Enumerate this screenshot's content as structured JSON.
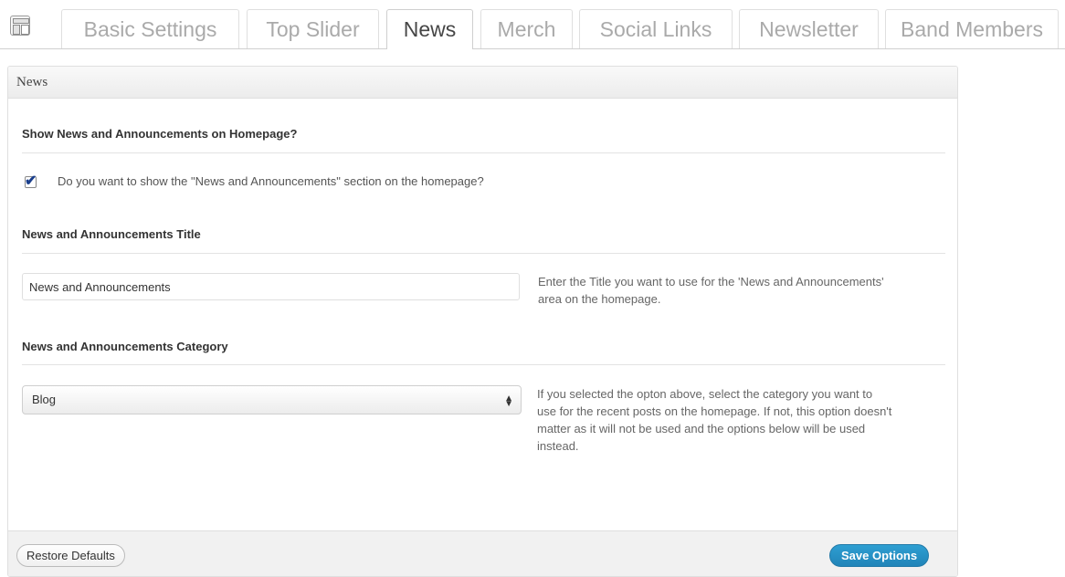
{
  "tabs": [
    {
      "label": "Basic Settings",
      "active": false
    },
    {
      "label": "Top Slider",
      "active": false
    },
    {
      "label": "News",
      "active": true
    },
    {
      "label": "Merch",
      "active": false
    },
    {
      "label": "Social Links",
      "active": false
    },
    {
      "label": "Newsletter",
      "active": false
    },
    {
      "label": "Band Members",
      "active": false
    }
  ],
  "panel": {
    "title": "News",
    "show_section": {
      "title": "Show News and Announcements on Homepage?",
      "checkbox_checked": true,
      "checkbox_label": "Do you want to show the \"News and Announcements\" section on the homepage?"
    },
    "title_section": {
      "title": "News and Announcements Title",
      "input_value": "News and Announcements",
      "description": "Enter the Title you want to use for the 'News and Announcements' area on the homepage."
    },
    "category_section": {
      "title": "News and Announcements Category",
      "selected": "Blog",
      "description": "If you selected the opton above, select the category you want to use for the recent posts on the homepage. If not, this option doesn't matter as it will not be used and the options below will be used instead."
    }
  },
  "footer": {
    "restore_label": "Restore Defaults",
    "save_label": "Save Options"
  },
  "colors": {
    "accent": "#2184b8",
    "checkbox_tick": "#1a3e8c"
  },
  "icons": {
    "page": "layout-icon",
    "select": "updown-arrows-icon",
    "checkbox": "checkmark-icon"
  }
}
